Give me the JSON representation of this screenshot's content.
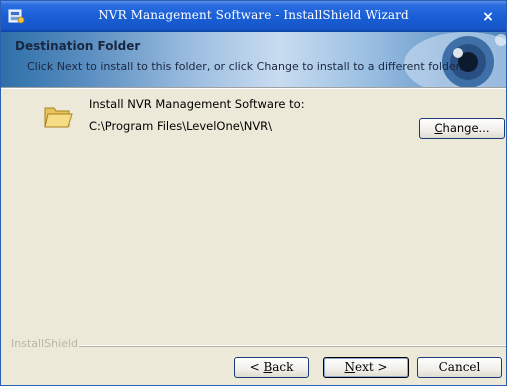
{
  "window": {
    "title": "NVR Management Software - InstallShield Wizard",
    "close_glyph": "×"
  },
  "header": {
    "title": "Destination Folder",
    "subtitle": "Click Next to install to this folder, or click Change to install to a different folder."
  },
  "content": {
    "install_label": "Install NVR Management Software to:",
    "install_path": "C:\\Program Files\\LevelOne\\NVR\\",
    "folder_icon": "folder-icon"
  },
  "buttons": {
    "change_prefix": "",
    "change_mnemonic": "C",
    "change_rest": "hange...",
    "back_prefix": "< ",
    "back_mnemonic": "B",
    "back_rest": "ack",
    "next_mnemonic": "N",
    "next_rest": "ext >",
    "cancel": "Cancel"
  },
  "footer": {
    "brand": "InstallShield"
  },
  "colors": {
    "titlebar": "#1a5fd6",
    "dialog_bg": "#ece9d8",
    "header_text": "#1a2740",
    "brand_text": "#b9b6ab"
  }
}
